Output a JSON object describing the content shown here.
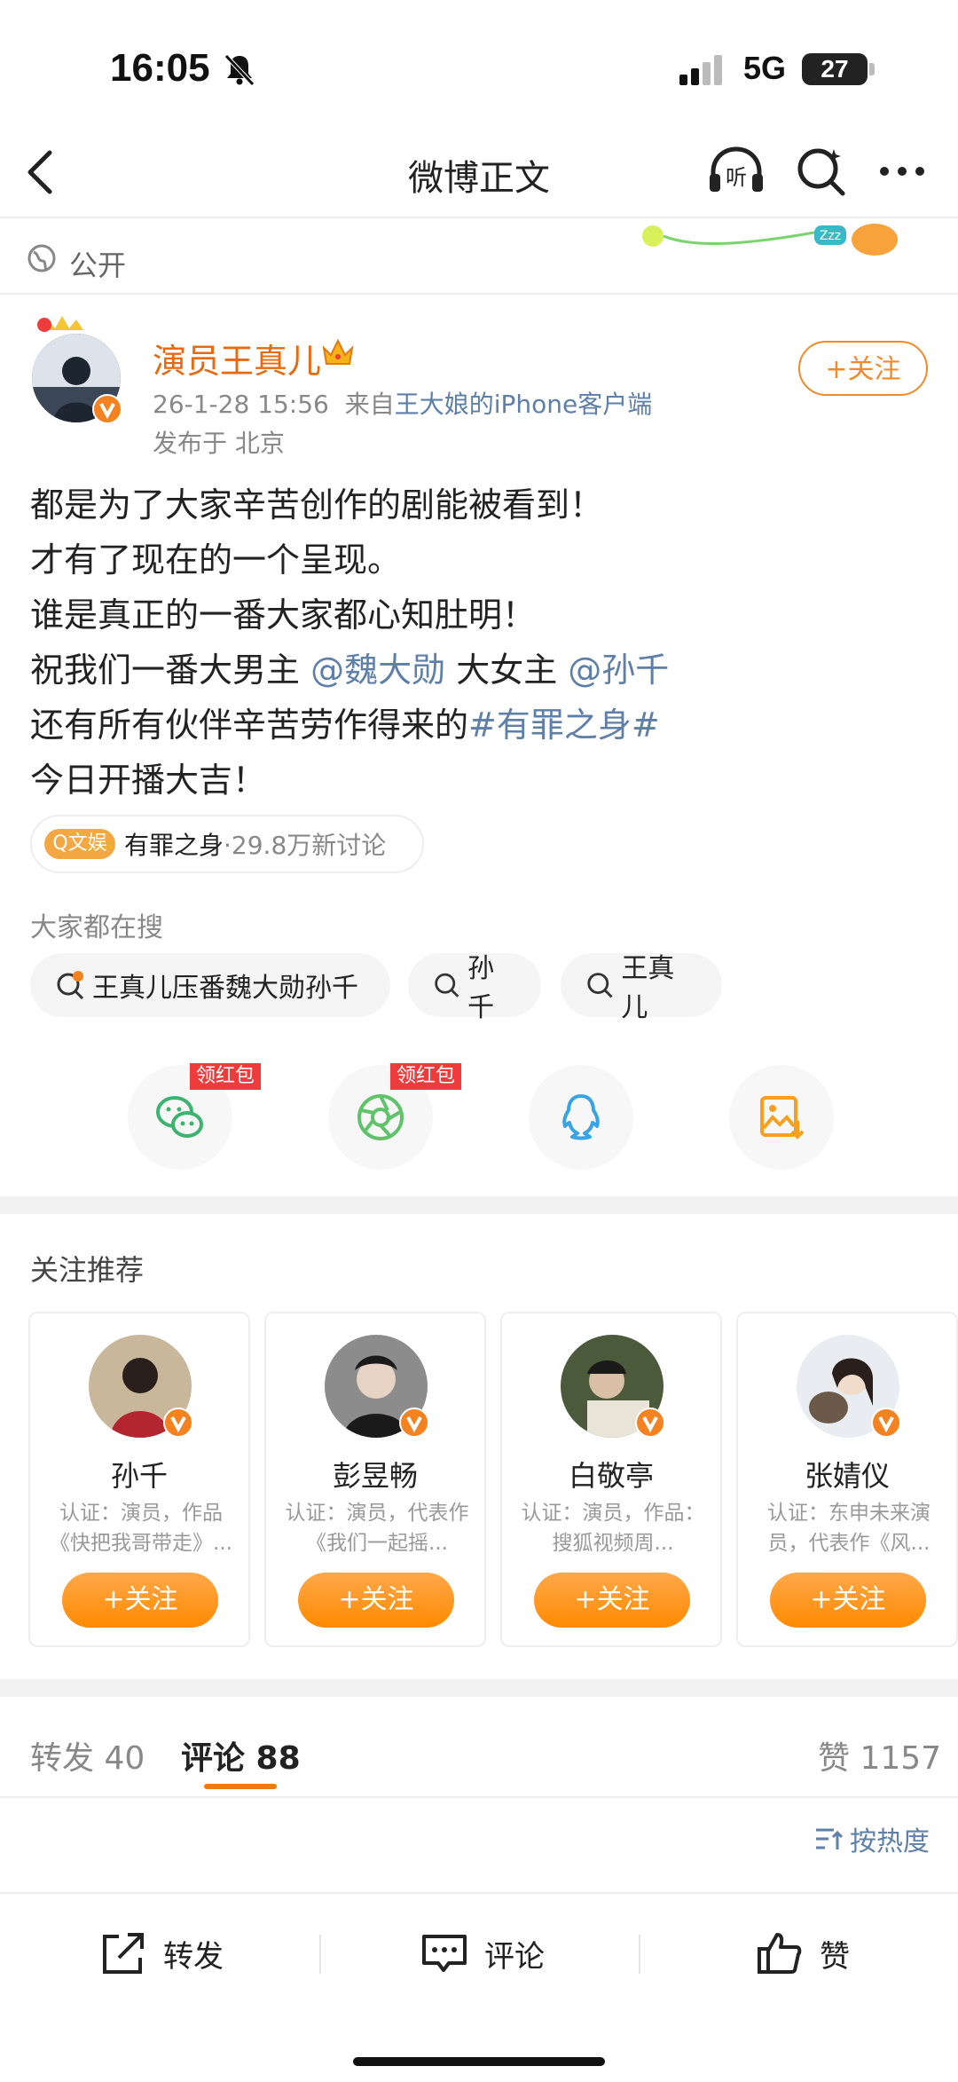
{
  "status_bar": {
    "time": "16:05",
    "network": "5G",
    "battery": "27"
  },
  "nav": {
    "title": "微博正文"
  },
  "visibility": "公开",
  "post": {
    "author": "演员王真儿",
    "date": "26-1-28 15:56",
    "source_prefix": "来自",
    "source": "王大娘的iPhone客户端",
    "location": "发布于 北京",
    "follow_label": "+关注",
    "lines": [
      {
        "text": "都是为了大家辛苦创作的剧能被看到！"
      },
      {
        "text": "才有了现在的一个呈现。"
      },
      {
        "text": "谁是真正的一番大家都心知肚明！"
      },
      {
        "pre": "祝我们一番大男主 ",
        "mention1": "@魏大勋",
        "mid": " 大女主 ",
        "mention2": "@孙千"
      },
      {
        "pre": "还有所有伙伴辛苦劳作得来的",
        "tag": "#有罪之身#"
      },
      {
        "text": "今日开播大吉！"
      }
    ],
    "topic": {
      "badge": "Q文娱",
      "name": "有罪之身",
      "count": "·29.8万新讨论"
    }
  },
  "searching": {
    "label": "大家都在搜",
    "chips": [
      "王真儿压番魏大勋孙千",
      "孙千",
      "王真儿"
    ]
  },
  "share": {
    "red_packet_label": "领红包"
  },
  "recommend": {
    "title": "关注推荐",
    "follow_label": "+关注",
    "cards": [
      {
        "name": "孙千",
        "desc": "认证：演员，作品《快把我哥带走》..."
      },
      {
        "name": "彭昱畅",
        "desc": "认证：演员，代表作《我们一起摇..."
      },
      {
        "name": "白敬亭",
        "desc": "认证：演员，作品：搜狐视频周..."
      },
      {
        "name": "张婧仪",
        "desc": "认证：东申未来演员，代表作《风..."
      }
    ]
  },
  "tabs": {
    "repost": "转发 40",
    "comment": "评论 88",
    "like": "赞 1157",
    "sort": "按热度"
  },
  "bottom_bar": {
    "repost": "转发",
    "comment": "评论",
    "like": "赞"
  },
  "colors": {
    "accent": "#f08a2a",
    "link": "#5d7fa8",
    "red_packet": "#ee3b3b"
  }
}
